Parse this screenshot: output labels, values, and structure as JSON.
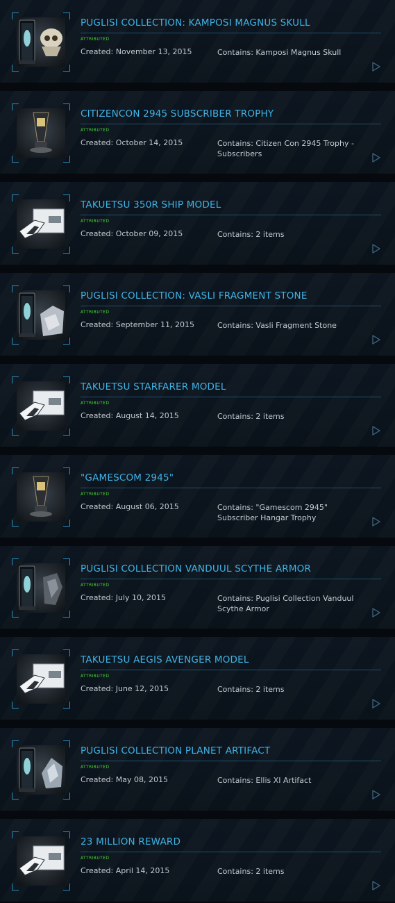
{
  "items": [
    {
      "title": "PUGLISI COLLECTION: KAMPOSI MAGNUS SKULL",
      "status": "ATTRIBUTED",
      "created": "Created: November 13, 2015",
      "contains": "Contains: Kamposi Magnus Skull",
      "thumb": "display-case-and-skull-image"
    },
    {
      "title": "CITIZENCON 2945 SUBSCRIBER TROPHY",
      "status": "ATTRIBUTED",
      "created": "Created: October 14, 2015",
      "contains": "Contains: Citizen Con 2945 Trophy - Subscribers",
      "thumb": "trophy-image"
    },
    {
      "title": "TAKUETSU 350R SHIP MODEL",
      "status": "ATTRIBUTED",
      "created": "Created: October 09, 2015",
      "contains": "Contains: 2 items",
      "thumb": "ship-model-box-image"
    },
    {
      "title": "PUGLISI COLLECTION: VASLI FRAGMENT STONE",
      "status": "ATTRIBUTED",
      "created": "Created: September 11, 2015",
      "contains": "Contains: Vasli Fragment Stone",
      "thumb": "display-case-and-stone-image"
    },
    {
      "title": "TAKUETSU STARFARER MODEL",
      "status": "ATTRIBUTED",
      "created": "Created: August 14, 2015",
      "contains": "Contains: 2 items",
      "thumb": "ship-model-box-image"
    },
    {
      "title": "\"GAMESCOM 2945\"",
      "status": "ATTRIBUTED",
      "created": "Created: August 06, 2015",
      "contains": "Contains: \"Gamescom 2945\" Subscriber Hangar Trophy",
      "thumb": "trophy-image"
    },
    {
      "title": "PUGLISI COLLECTION VANDUUL SCYTHE ARMOR",
      "status": "ATTRIBUTED",
      "created": "Created: July 10, 2015",
      "contains": "Contains: Puglisi Collection Vanduul Scythe Armor",
      "thumb": "display-case-and-armor-image"
    },
    {
      "title": "TAKUETSU AEGIS AVENGER MODEL",
      "status": "ATTRIBUTED",
      "created": "Created: June 12, 2015",
      "contains": "Contains: 2 items",
      "thumb": "ship-model-box-image"
    },
    {
      "title": "PUGLISI COLLECTION PLANET ARTIFACT",
      "status": "ATTRIBUTED",
      "created": "Created: May 08, 2015",
      "contains": "Contains: Ellis XI Artifact",
      "thumb": "display-case-and-artifact-image"
    },
    {
      "title": "23 MILLION REWARD",
      "status": "ATTRIBUTED",
      "created": "Created: April 14, 2015",
      "contains": "Contains: 2 items",
      "thumb": "ship-model-box-image"
    }
  ],
  "icons": {
    "arrow": "play-arrow-icon"
  },
  "colors": {
    "title": "#3fb3e6",
    "status": "#49d834",
    "text": "#c3cad2",
    "frame": "#2d8fc1"
  }
}
